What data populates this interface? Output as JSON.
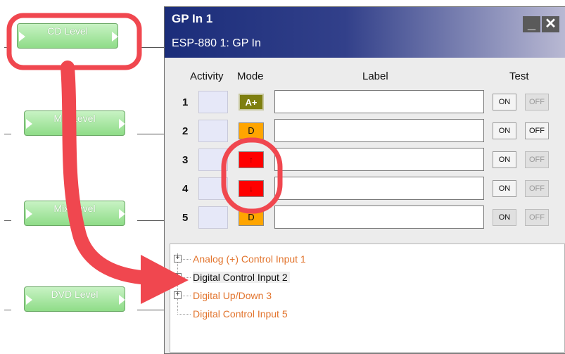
{
  "blocks": [
    {
      "label": "CD Level"
    },
    {
      "label": "Mic Level"
    },
    {
      "label": "Mix Level"
    },
    {
      "label": "DVD Level"
    }
  ],
  "window": {
    "title": "GP In 1",
    "subtitle": "ESP-880 1: GP In",
    "minimize_glyph": "_",
    "close_glyph": "✕"
  },
  "headers": {
    "activity": "Activity",
    "mode": "Mode",
    "label": "Label",
    "test": "Test"
  },
  "rows": [
    {
      "num": "1",
      "mode_glyph": "A+",
      "label_value": "",
      "on": "ON",
      "off": "OFF"
    },
    {
      "num": "2",
      "mode_glyph": "D",
      "label_value": "",
      "on": "ON",
      "off": "OFF"
    },
    {
      "num": "3",
      "mode_glyph": "↑",
      "label_value": "",
      "on": "ON",
      "off": "OFF"
    },
    {
      "num": "4",
      "mode_glyph": "↓",
      "label_value": "",
      "on": "ON",
      "off": "OFF"
    },
    {
      "num": "5",
      "mode_glyph": "D",
      "label_value": "",
      "on": "ON",
      "off": "OFF"
    }
  ],
  "tree": [
    {
      "label": "Analog (+) Control Input 1",
      "expander": "+"
    },
    {
      "label": "Digital Control Input 2",
      "expander": "+"
    },
    {
      "label": "Digital Up/Down 3",
      "expander": "+"
    },
    {
      "label": "Digital Control Input 5",
      "expander": ""
    }
  ],
  "colors": {
    "titlebar_start": "#1b2d7a",
    "annotation_red": "#f0474f",
    "block_green": "#8fdc88",
    "tree_orange": "#e2742d"
  }
}
